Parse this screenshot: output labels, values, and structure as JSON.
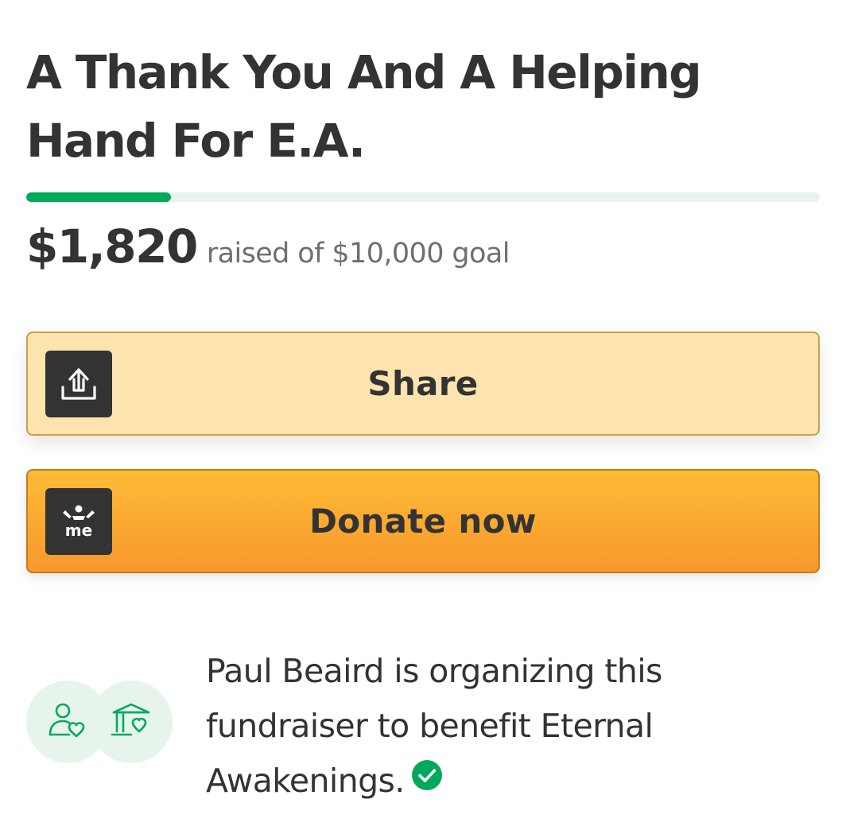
{
  "fundraiser": {
    "title": "A Thank You And A Helping Hand For E.A.",
    "raised_amount": "$1,820",
    "goal_text": "raised of $10,000 goal",
    "progress_fraction": 0.182
  },
  "actions": {
    "share_label": "Share",
    "share_icon": "share-upload-icon",
    "donate_label": "Donate now",
    "donate_icon": "gofundme-logo-icon"
  },
  "organizer": {
    "text": "Paul Beaird is organizing this fundraiser to benefit Eternal Awakenings.",
    "person_icon": "person-heart-icon",
    "charity_icon": "charity-building-heart-icon",
    "verified_icon": "verified-check-icon"
  },
  "colors": {
    "brand_green": "#02a95c",
    "progress_track": "#e9f4ee",
    "share_bg": "#fde3ae",
    "donate_bg_top": "#fdbb36",
    "donate_bg_bottom": "#f7982c",
    "text_dark": "#333333",
    "text_muted": "#6f6f6f",
    "avatar_bg": "#e6f4ec"
  }
}
